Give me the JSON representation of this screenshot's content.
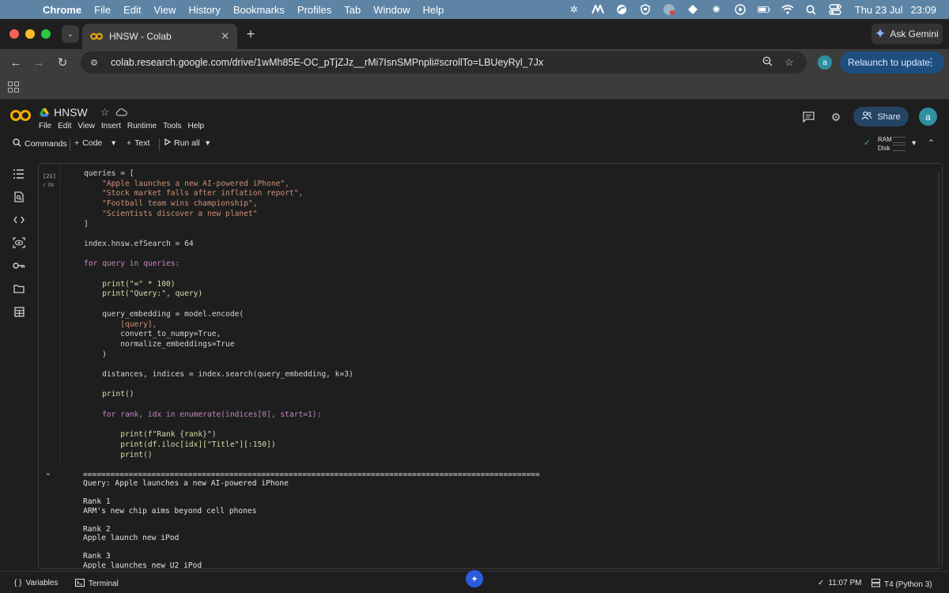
{
  "os_menubar": {
    "apple_glyph": "",
    "app_name": "Chrome",
    "menus": [
      "File",
      "Edit",
      "View",
      "History",
      "Bookmarks",
      "Profiles",
      "Tab",
      "Window",
      "Help"
    ],
    "date": "Thu 23 Jul",
    "time": "23:09"
  },
  "browser": {
    "tab_title": "HNSW - Colab",
    "new_tab_glyph": "+",
    "ask_gemini_label": "Ask Gemini",
    "url": "colab.research.google.com/drive/1wMh85E-OC_pTjZJz__rMi7IsnSMPnpli#scrollTo=LBUeyRyl_7Jx",
    "profile_initial": "a",
    "relaunch_label": "Relaunch to update"
  },
  "colab": {
    "notebook_title": "HNSW",
    "menu": [
      "File",
      "Edit",
      "View",
      "Insert",
      "Runtime",
      "Tools",
      "Help"
    ],
    "share_label": "Share",
    "user_initial": "a",
    "commands_label": "Commands",
    "code_label": "Code",
    "text_label": "Text",
    "run_all_label": "Run all",
    "ram_label": "RAM",
    "disk_label": "Disk"
  },
  "cell": {
    "execution_count": "[21]",
    "execution_time": "0s",
    "code": [
      "queries = [",
      "    \"Apple launches a new AI-powered iPhone\",",
      "    \"Stock market falls after inflation report\",",
      "    \"Football team wins championship\",",
      "    \"Scientists discover a new planet\"",
      "]",
      "",
      "index.hnsw.efSearch = 64",
      "",
      "for query in queries:",
      "",
      "    print(\"=\" * 100)",
      "    print(\"Query:\", query)",
      "",
      "    query_embedding = model.encode(",
      "        [query],",
      "        convert_to_numpy=True,",
      "        normalize_embeddings=True",
      "    )",
      "",
      "    distances, indices = index.search(query_embedding, k=3)",
      "",
      "    print()",
      "",
      "    for rank, idx in enumerate(indices[0], start=1):",
      "",
      "        print(f\"Rank {rank}\")",
      "        print(df.iloc[idx][\"Title\"][:150])",
      "        print()"
    ],
    "output": [
      "====================================================================================================",
      "Query: Apple launches a new AI-powered iPhone",
      "",
      "Rank 1",
      "ARM's new chip aims beyond cell phones",
      "",
      "Rank 2",
      "Apple launch new iPod",
      "",
      "Rank 3",
      "Apple launches new U2 iPod"
    ]
  },
  "statusbar": {
    "variables_label": "Variables",
    "terminal_label": "Terminal",
    "run_time": "11:07 PM",
    "runtime_label": "T4 (Python 3)"
  }
}
